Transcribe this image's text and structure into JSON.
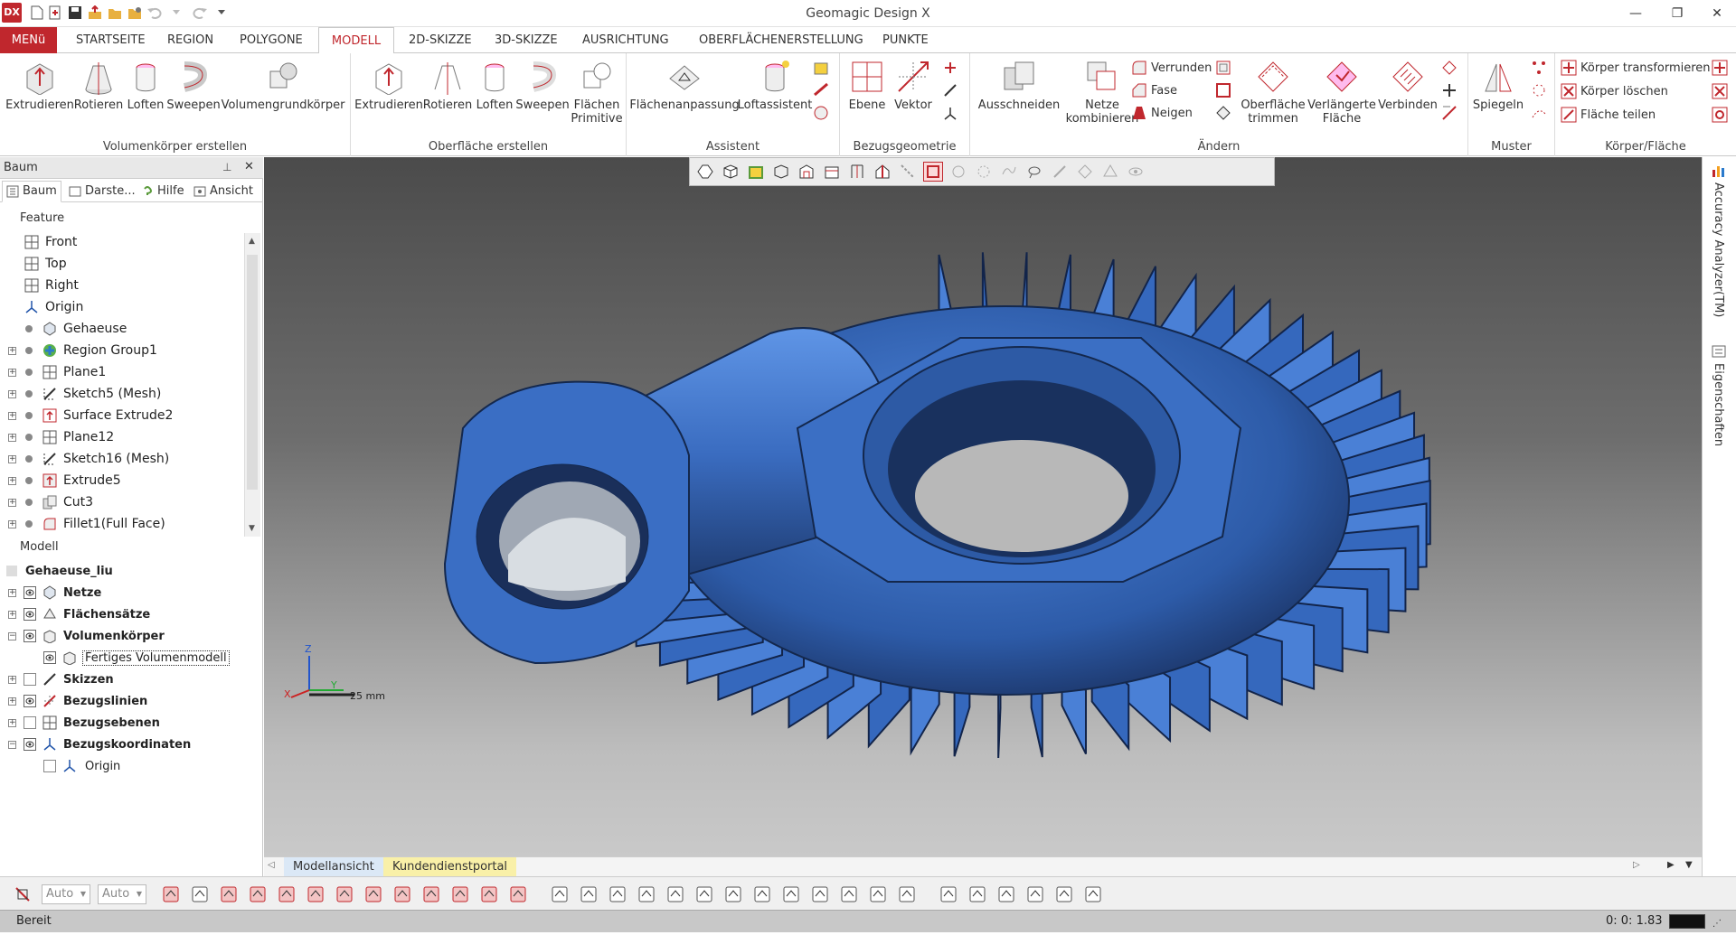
{
  "window": {
    "title": "Geomagic Design X",
    "app_icon": "DX"
  },
  "ribbon_tabs": [
    "MENü",
    "STARTSEITE",
    "REGION",
    "POLYGONE",
    "MODELL",
    "2D-SKIZZE",
    "3D-SKIZZE",
    "AUSRICHTUNG",
    "OBERFLÄCHENERSTELLUNG",
    "PUNKTE"
  ],
  "active_tab": "MODELL",
  "ribbon": {
    "g1": {
      "label": "Volumenkörper erstellen",
      "b": [
        "Extrudieren",
        "Rotieren",
        "Loften",
        "Sweepen",
        "Volumengrundkörper"
      ]
    },
    "g2": {
      "label": "Oberfläche erstellen",
      "b": [
        "Extrudieren",
        "Rotieren",
        "Loften",
        "Sweepen",
        "Flächen",
        "Primitive"
      ]
    },
    "g3": {
      "label": "Assistent",
      "b": [
        "Flächenanpassung",
        "Loftassistent"
      ]
    },
    "g4": {
      "label": "Bezugsgeometrie",
      "b": [
        "Ebene",
        "Vektor"
      ]
    },
    "g5": {
      "label": "Ändern",
      "b": [
        "Ausschneiden",
        "Netze",
        "kombinieren",
        "Verrunden",
        "Fase",
        "Neigen",
        "Oberfläche",
        "trimmen",
        "Verlängerte",
        "Fläche",
        "Verbinden"
      ]
    },
    "g6": {
      "label": "Muster",
      "b": [
        "Spiegeln"
      ]
    },
    "g7": {
      "label": "Körper/Fläche",
      "b": [
        "Körper transformieren",
        "Körper löschen",
        "Fläche teilen"
      ]
    }
  },
  "panel": {
    "title": "Baum",
    "tabs": [
      "Baum",
      "Darste...",
      "Hilfe",
      "Ansicht"
    ],
    "feature_label": "Feature",
    "features": [
      "Front",
      "Top",
      "Right",
      "Origin",
      "Gehaeuse",
      "Region Group1",
      "Plane1",
      "Sketch5 (Mesh)",
      "Surface Extrude2",
      "Plane12",
      "Sketch16 (Mesh)",
      "Extrude5",
      "Cut3",
      "Fillet1(Full Face)"
    ],
    "model_label": "Modell",
    "model": [
      "Gehaeuse_liu",
      "Netze",
      "Flächensätze",
      "Volumenkörper",
      "Fertiges Volumenmodell",
      "Skizzen",
      "Bezugslinien",
      "Bezugsebenen",
      "Bezugskoordinaten",
      "Origin"
    ]
  },
  "viewport": {
    "scale_label": "25 mm",
    "axis": [
      "Z",
      "Y",
      "X"
    ],
    "tabs": [
      "Modellansicht",
      "Kundendienstportal"
    ]
  },
  "right_tabs": [
    "Accuracy Analyzer(TM)",
    "Eigenschaften"
  ],
  "bottom": {
    "combo1": "Auto",
    "combo2": "Auto"
  },
  "status": {
    "text": "Bereit",
    "coord": "0: 0: 1.83"
  },
  "colors": {
    "accent": "#c0272d",
    "model_blue": "#3b6fc4"
  }
}
